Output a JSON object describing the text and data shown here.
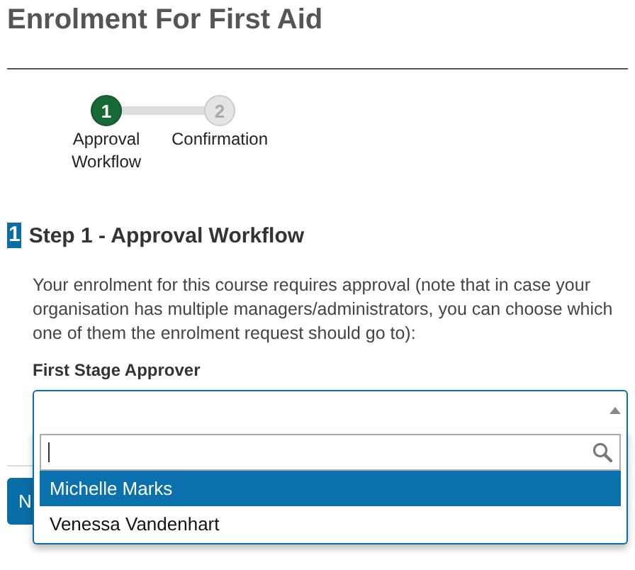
{
  "title": "Enrolment For First Aid",
  "steps": [
    {
      "number": "1",
      "label": "Approval Workflow",
      "selected": true
    },
    {
      "number": "2",
      "label": "Confirmation",
      "selected": false
    }
  ],
  "section": {
    "number": "1",
    "title": "Step 1 - Approval Workflow"
  },
  "intro": "Your enrolment for this course requires approval (note that in case your organisation has multiple managers/administrators, you can choose which one of them the enrolment request should go to):",
  "approver": {
    "label": "First Stage Approver",
    "expanded": true,
    "options": [
      {
        "label": "Michelle Marks",
        "selected": true
      },
      {
        "label": "Venessa Vandenhart",
        "selected": false
      }
    ]
  },
  "button": {
    "label": "N"
  }
}
